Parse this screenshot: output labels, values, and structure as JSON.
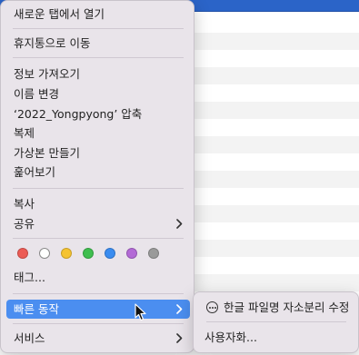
{
  "menu": {
    "items": [
      {
        "label": "새로운 탭에서 열기"
      },
      {
        "label": "휴지통으로 이동"
      },
      {
        "label": "정보 가져오기"
      },
      {
        "label": "이름 변경"
      },
      {
        "label": "‘2022_Yongpyong’ 압축"
      },
      {
        "label": "복제"
      },
      {
        "label": "가상본 만들기"
      },
      {
        "label": "훑어보기"
      },
      {
        "label": "복사"
      },
      {
        "label": "공유"
      },
      {
        "label": "태그..."
      },
      {
        "label": "빠른 동작"
      },
      {
        "label": "서비스"
      }
    ],
    "tag_colors": [
      "#ec5b55",
      "#ffffff",
      "#f5c330",
      "#3fbe4f",
      "#3a8cf0",
      "#b36ad6",
      "#9a9a9a"
    ]
  },
  "submenu": {
    "items": [
      {
        "label": "한글 파일명 자소분리 수정"
      },
      {
        "label": "사용자화..."
      }
    ]
  },
  "colors": {
    "highlight": "#4b8ef0",
    "menu_bg": "#e9e4ea"
  }
}
